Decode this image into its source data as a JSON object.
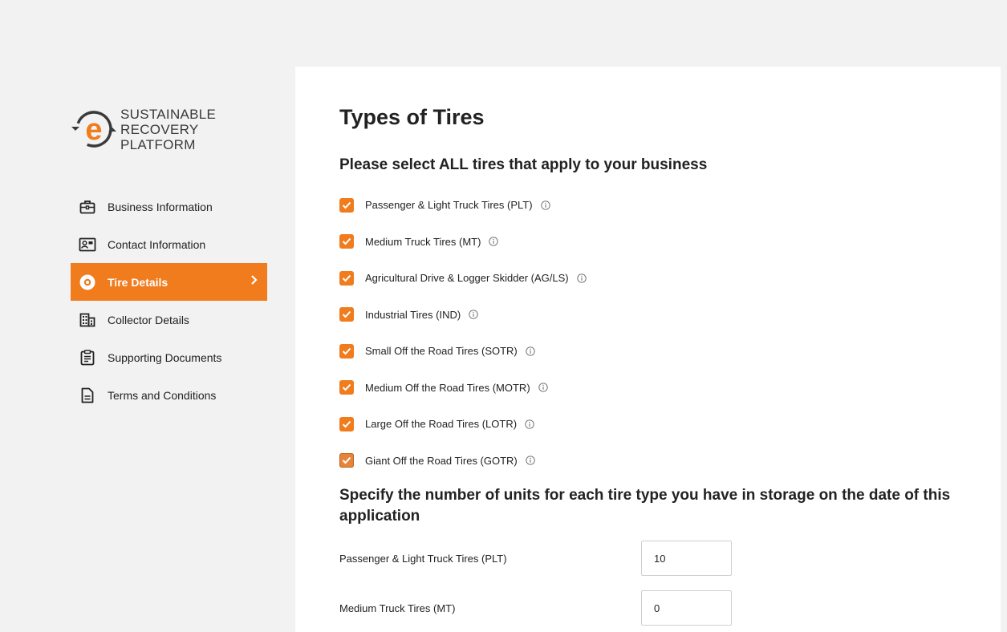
{
  "brand": {
    "line1": "SUSTAINABLE",
    "line2": "RECOVERY",
    "line3": "PLATFORM",
    "accent_color": "#f07c1e"
  },
  "sidebar": {
    "items": [
      {
        "label": "Business Information",
        "icon": "briefcase-icon",
        "active": false
      },
      {
        "label": "Contact Information",
        "icon": "contact-card-icon",
        "active": false
      },
      {
        "label": "Tire Details",
        "icon": "tire-icon",
        "active": true
      },
      {
        "label": "Collector Details",
        "icon": "building-icon",
        "active": false
      },
      {
        "label": "Supporting Documents",
        "icon": "clipboard-icon",
        "active": false
      },
      {
        "label": "Terms and Conditions",
        "icon": "document-icon",
        "active": false
      }
    ]
  },
  "main": {
    "title": "Types of Tires",
    "select_heading": "Please select ALL tires that apply to your business",
    "tire_types": [
      {
        "label": "Passenger & Light Truck Tires (PLT)",
        "checked": true
      },
      {
        "label": "Medium Truck Tires (MT)",
        "checked": true
      },
      {
        "label": "Agricultural Drive & Logger Skidder (AG/LS)",
        "checked": true
      },
      {
        "label": "Industrial Tires (IND)",
        "checked": true
      },
      {
        "label": "Small Off the Road Tires (SOTR)",
        "checked": true
      },
      {
        "label": "Medium Off the Road Tires (MOTR)",
        "checked": true
      },
      {
        "label": "Large Off the Road Tires (LOTR)",
        "checked": true
      },
      {
        "label": "Giant Off the Road Tires (GOTR)",
        "checked": true
      }
    ],
    "storage_heading": "Specify the number of units for each tire type you have in storage on the date of this application",
    "storage": [
      {
        "label": "Passenger & Light Truck Tires (PLT)",
        "value": "10"
      },
      {
        "label": "Medium Truck Tires (MT)",
        "value": "0"
      }
    ]
  }
}
